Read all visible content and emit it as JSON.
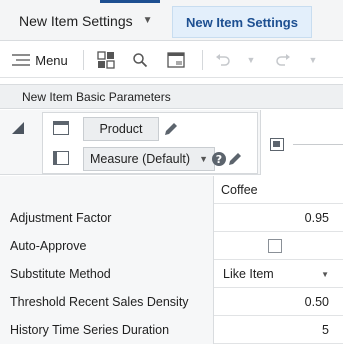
{
  "tabs": {
    "dropdown_label": "New Item Settings",
    "active_label": "New Item Settings"
  },
  "toolbar": {
    "menu_label": "Menu",
    "icons": [
      "hamburger-menu-icon",
      "layout-icon",
      "search-icon",
      "table-icon",
      "undo-icon",
      "redo-icon"
    ]
  },
  "panel": {
    "title": "New Item Basic Parameters"
  },
  "pivot": {
    "row_dimension": "Product",
    "column_dimension": "Measure (Default)"
  },
  "grid": {
    "column_header": "Coffee",
    "rows": [
      {
        "label": "Adjustment Factor",
        "value": "0.95",
        "type": "number"
      },
      {
        "label": "Auto-Approve",
        "value": "",
        "type": "checkbox",
        "checked": false
      },
      {
        "label": "Substitute Method",
        "value": "Like Item",
        "type": "select"
      },
      {
        "label": "Threshold Recent Sales Density",
        "value": "0.50",
        "type": "number"
      },
      {
        "label": "History Time Series Duration",
        "value": "5",
        "type": "number"
      }
    ]
  },
  "colors": {
    "accent": "#1d4f91",
    "active_tab_bg": "#e3effb",
    "header_bg": "#eef0f2"
  }
}
